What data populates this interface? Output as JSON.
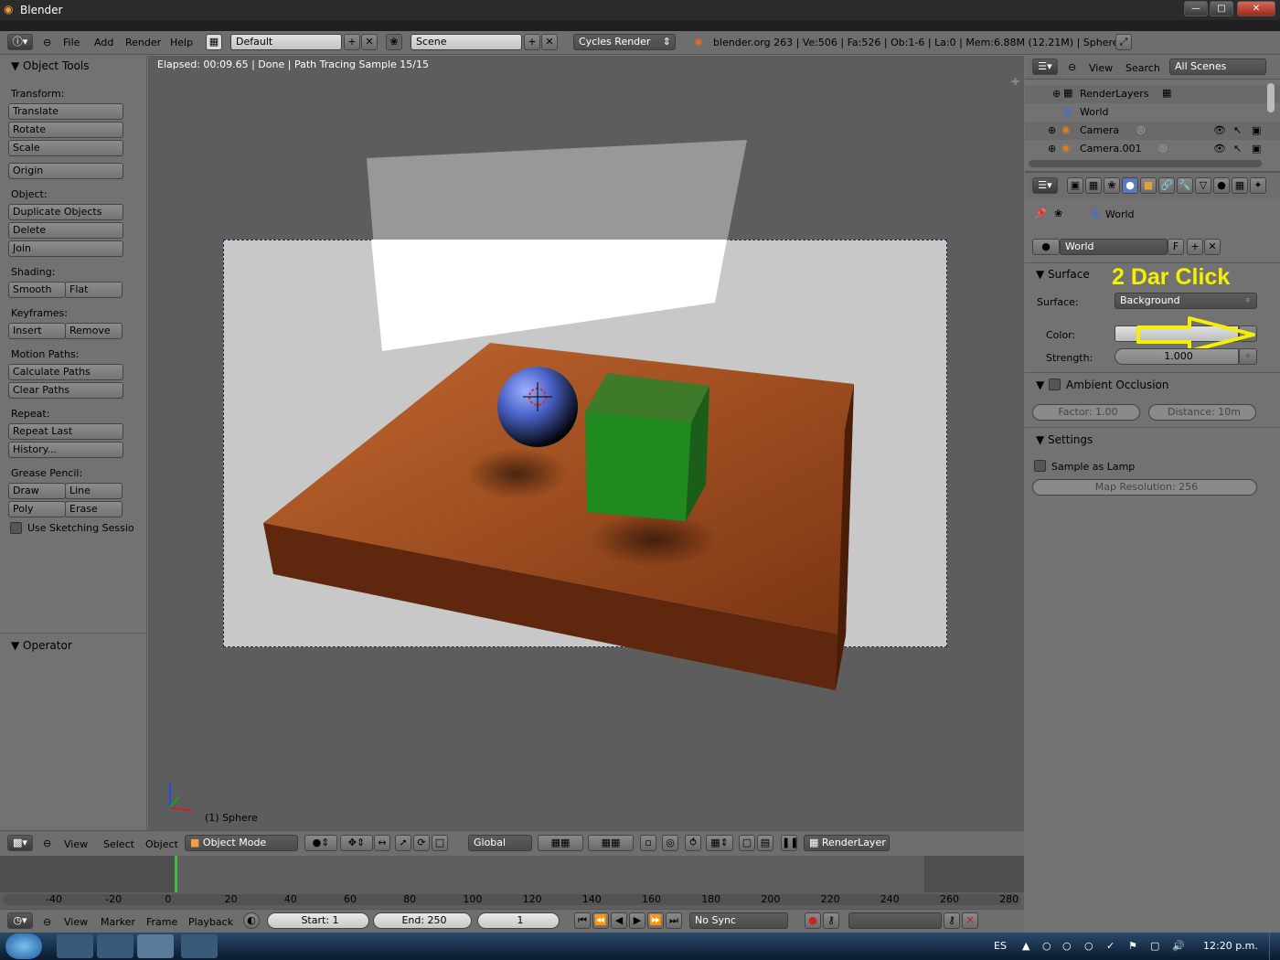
{
  "window": {
    "title": "Blender"
  },
  "topbar": {
    "menus": [
      "File",
      "Add",
      "Render",
      "Help"
    ],
    "screen_layout": "Default",
    "scene": "Scene",
    "render_engine": "Cycles Render",
    "stats": "blender.org 263 | Ve:506 | Fa:526 | Ob:1-6 | La:0 | Mem:6.88M (12.21M) | Sphere"
  },
  "tools": {
    "title": "Object Tools",
    "transform_label": "Transform:",
    "translate": "Translate",
    "rotate": "Rotate",
    "scale": "Scale",
    "origin": "Origin",
    "object_label": "Object:",
    "duplicate": "Duplicate Objects",
    "delete": "Delete",
    "join": "Join",
    "shading_label": "Shading:",
    "smooth": "Smooth",
    "flat": "Flat",
    "keyframes_label": "Keyframes:",
    "insert": "Insert",
    "remove": "Remove",
    "motion_label": "Motion Paths:",
    "calc_paths": "Calculate Paths",
    "clear_paths": "Clear Paths",
    "repeat_label": "Repeat:",
    "repeat_last": "Repeat Last",
    "history": "History...",
    "grease_label": "Grease Pencil:",
    "draw": "Draw",
    "line": "Line",
    "poly": "Poly",
    "erase": "Erase",
    "sketching": "Use Sketching Sessio",
    "operator": "Operator"
  },
  "viewport": {
    "status": "Elapsed: 00:09.65 | Done | Path Tracing Sample 15/15",
    "object_label": "(1) Sphere"
  },
  "view_header": {
    "menus": [
      "View",
      "Select",
      "Object"
    ],
    "mode": "Object Mode",
    "orientation": "Global",
    "render_layer": "RenderLayer"
  },
  "timeline": {
    "ticks": [
      "-40",
      "-20",
      "0",
      "20",
      "40",
      "60",
      "80",
      "100",
      "120",
      "140",
      "160",
      "180",
      "200",
      "220",
      "240",
      "260",
      "280"
    ],
    "menus": [
      "View",
      "Marker",
      "Frame",
      "Playback"
    ],
    "start": "Start: 1",
    "end": "End: 250",
    "current": "1",
    "sync": "No Sync"
  },
  "outliner": {
    "menus": [
      "View",
      "Search"
    ],
    "filter": "All Scenes",
    "items": [
      "RenderLayers",
      "World",
      "Camera",
      "Camera.001"
    ]
  },
  "properties": {
    "breadcrumb": "World",
    "world_name": "World",
    "world_f": "F",
    "surface_header": "Surface",
    "annotation": "2 Dar Click",
    "surface_label": "Surface:",
    "surface_value": "Background",
    "color_label": "Color:",
    "strength_label": "Strength:",
    "strength_value": "1.000",
    "ao_header": "Ambient Occlusion",
    "ao_factor": "Factor: 1.00",
    "ao_distance": "Distance: 10m",
    "settings_header": "Settings",
    "sample_lamp": "Sample as Lamp",
    "map_resolution": "Map Resolution: 256"
  },
  "taskbar": {
    "lang": "ES",
    "clock": "12:20 p.m."
  },
  "colors": {
    "annotation": "#f5f000",
    "table": "#b35a2a",
    "sphere": "#4a64c8",
    "cube": "#2a8a2a"
  }
}
